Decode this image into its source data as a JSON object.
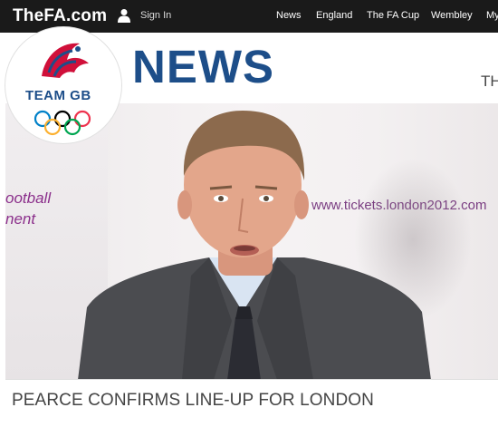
{
  "topbar": {
    "site_name": "TheFA.com",
    "sign_in_label": "Sign In",
    "nav": {
      "news": "News",
      "england": "England",
      "fa_cup": "The FA Cup",
      "wembley": "Wembley",
      "my": "My"
    }
  },
  "header": {
    "section_title": "NEWS",
    "badge_text": "TEAM GB",
    "trailing_text": "TH"
  },
  "photo": {
    "backdrop_text_line1": "ootball",
    "backdrop_text_line2": "nent",
    "backdrop_url": "www.tickets.london2012.com"
  },
  "article": {
    "headline": "PEARCE CONFIRMS LINE-UP FOR LONDON"
  },
  "colors": {
    "topbar_bg": "#1a1a1a",
    "brand_blue": "#1d4e89",
    "teamgb_red": "#d0103a",
    "headline_gray": "#444444"
  },
  "icons": {
    "sign_in": "user-icon",
    "badge_emblem": "lion-icon",
    "rings": "olympic-rings-icon"
  }
}
